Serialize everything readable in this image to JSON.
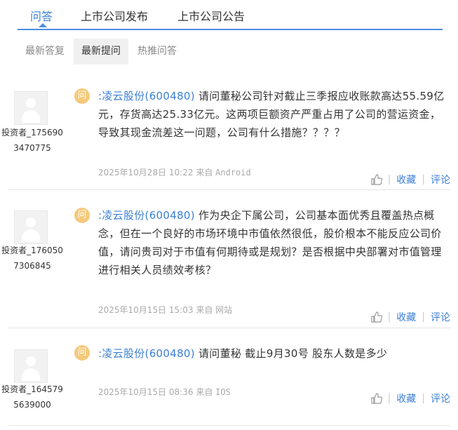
{
  "tabs": [
    {
      "label": "问答",
      "active": true
    },
    {
      "label": "上市公司发布",
      "active": false
    },
    {
      "label": "上市公司公告",
      "active": false
    }
  ],
  "subtabs": [
    {
      "label": "最新答复",
      "active": false
    },
    {
      "label": "最新提问",
      "active": true
    },
    {
      "label": "热推问答",
      "active": false
    }
  ],
  "questions": [
    {
      "user": "投资者_1756903470775",
      "badge": "问",
      "company": ":凌云股份(600480)",
      "text": "请问董秘公司针对截止三季报应收账款高达55.59亿元，存货高达25.33亿元。这两项巨额资产严重占用了公司的营运资金，导致其现金流差这一问题，公司有什么措施？？？？",
      "date": "2025年10月28日 10:22",
      "source_prefix": "来自",
      "source": "Android",
      "like_icon": "thumbs-up-icon",
      "collect_label": "收藏",
      "comment_label": "评论"
    },
    {
      "user": "投资者_1760507306845",
      "badge": "问",
      "company": ":凌云股份(600480)",
      "text": "作为央企下属公司，公司基本面优秀且覆盖热点概念，但在一个良好的市场环境中市值依然很低，股价根本不能反应公司价值，请问贵司对于市值有何期待或是规划？是否根据中央部署对市值管理进行相关人员绩效考核？",
      "date": "2025年10月15日 15:03",
      "source_prefix": "来自",
      "source": "网站",
      "like_icon": "thumbs-up-icon",
      "collect_label": "收藏",
      "comment_label": "评论"
    },
    {
      "user": "投资者_1645795639000",
      "badge": "问",
      "company": ":凌云股份(600480)",
      "text": "请问董秘 截止9月30号 股东人数是多少",
      "date": "2025年10月15日 08:36",
      "source_prefix": "来自",
      "source": "IOS",
      "like_icon": "thumbs-up-icon",
      "collect_label": "收藏",
      "comment_label": "评论"
    }
  ],
  "colors": {
    "accent": "#3b7fd6",
    "badge": "#f5c97a",
    "meta": "#aaaaaa"
  }
}
